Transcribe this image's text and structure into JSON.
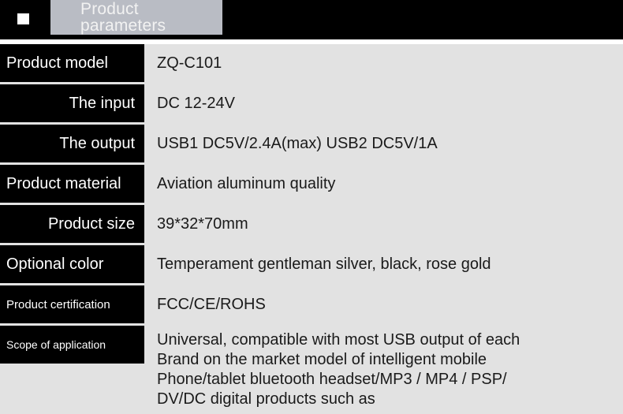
{
  "header": {
    "bullet_icon": "filled-square-icon",
    "title": "Product parameters",
    "chip_color": "#b9bcc4",
    "band_color": "#000000"
  },
  "colors": {
    "page_background": "#e2e2e2",
    "label_background": "#000000",
    "label_text": "#ffffff",
    "value_text": "#1a1a1a"
  },
  "spec_table": {
    "rows": [
      {
        "label": "Product model",
        "value": "ZQ-C101"
      },
      {
        "label": "The input",
        "value": "DC 12-24V"
      },
      {
        "label": "The output",
        "value": "USB1 DC5V/2.4A(max) USB2 DC5V/1A"
      },
      {
        "label": "Product material",
        "value": "Aviation aluminum quality"
      },
      {
        "label": "Product size",
        "value": "39*32*70mm"
      },
      {
        "label": "Optional color",
        "value": "Temperament gentleman silver, black, rose gold"
      },
      {
        "label": "Product certification",
        "value": "FCC/CE/ROHS"
      },
      {
        "label": "Scope of application",
        "value_lines": [
          "Universal, compatible with most USB output of each",
          "Brand on the market model of intelligent mobile",
          "Phone/tablet bluetooth headset/MP3 / MP4 / PSP/",
          "DV/DC digital products such as"
        ]
      }
    ]
  }
}
